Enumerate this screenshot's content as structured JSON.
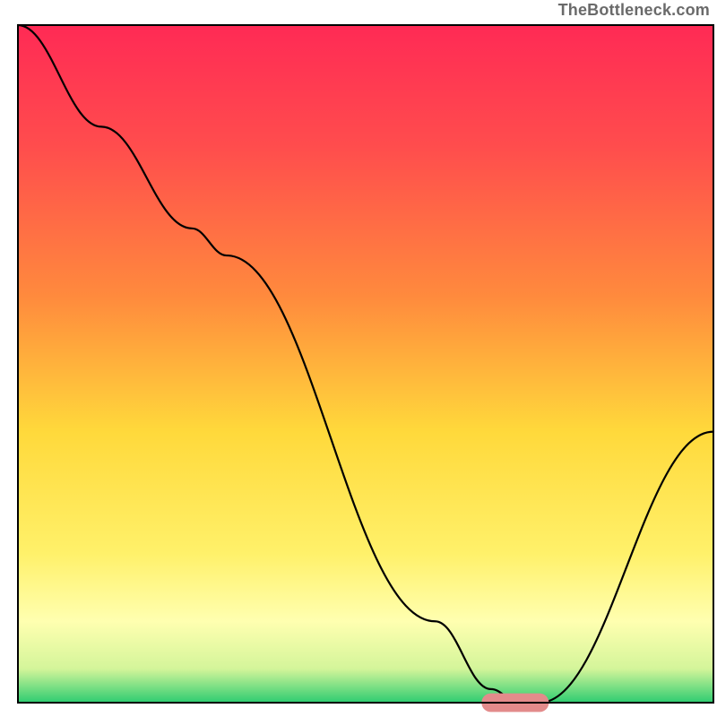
{
  "watermark": "TheBottleneck.com",
  "chart_data": {
    "type": "line",
    "title": "",
    "xlabel": "",
    "ylabel": "",
    "xlim": [
      0,
      100
    ],
    "ylim": [
      0,
      100
    ],
    "grid": false,
    "legend": false,
    "background_gradient_stops": [
      {
        "offset": 0,
        "color": "#ff2a55"
      },
      {
        "offset": 18,
        "color": "#ff4d4d"
      },
      {
        "offset": 40,
        "color": "#ff8a3d"
      },
      {
        "offset": 60,
        "color": "#ffd93b"
      },
      {
        "offset": 78,
        "color": "#fff16a"
      },
      {
        "offset": 88,
        "color": "#ffffb0"
      },
      {
        "offset": 95,
        "color": "#d4f59a"
      },
      {
        "offset": 100,
        "color": "#2ecc71"
      }
    ],
    "curve": {
      "x": [
        0,
        12,
        25,
        30,
        60,
        68,
        72,
        75,
        100
      ],
      "y": [
        100,
        85,
        70,
        66,
        12,
        2,
        0,
        0,
        40
      ]
    },
    "marker_segment": {
      "x0": 68,
      "x1": 75,
      "y": 0,
      "color": "#e38b8b",
      "thickness": 2.6
    },
    "axis_box": {
      "x": 2.5,
      "y": 3.5,
      "w": 97,
      "h": 94.5,
      "stroke": "#000000",
      "stroke_width": 0.25
    }
  }
}
